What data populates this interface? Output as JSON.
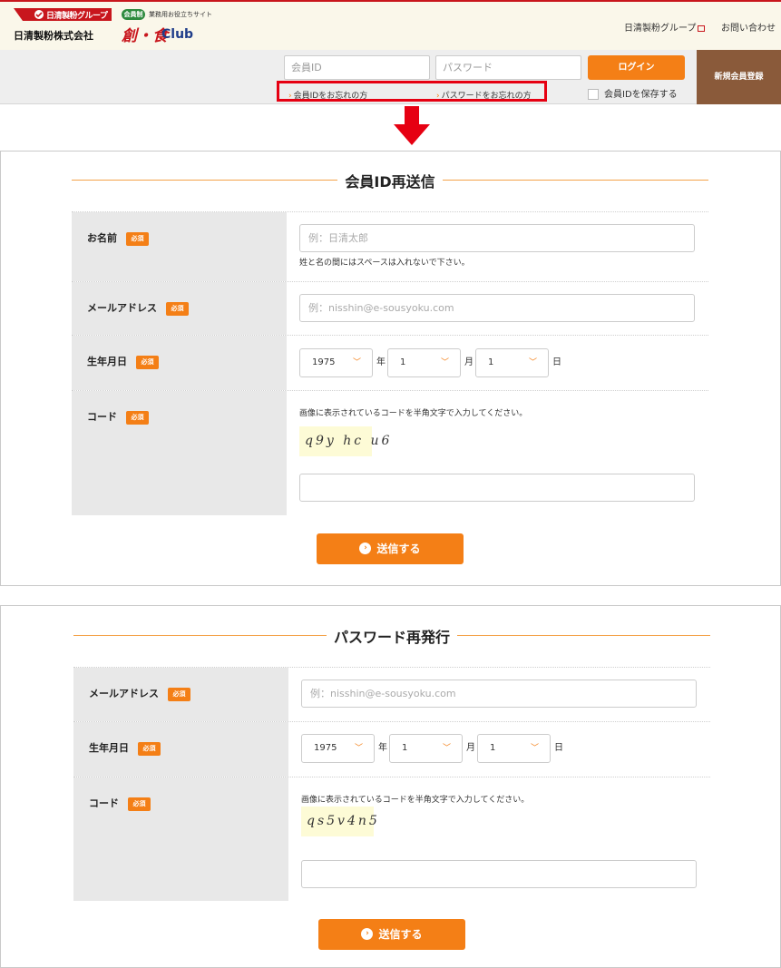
{
  "header": {
    "group_logo_banner": "日清製粉グループ",
    "group_logo_company": "日清製粉株式会社",
    "club_badge": "会員制",
    "club_tagline": "業務用お役立ちサイト",
    "club_name_main": "創・食",
    "club_name_sub": "Club",
    "link_group": "日清製粉グループ",
    "link_contact": "お問い合わせ"
  },
  "login_bar": {
    "id_placeholder": "会員ID",
    "password_placeholder": "パスワード",
    "login_button": "ログイン",
    "forgot_id": "会員IDをお忘れの方",
    "forgot_password": "パスワードをお忘れの方",
    "save_id": "会員IDを保存する",
    "register": "新規会員登録"
  },
  "colors": {
    "accent": "#f47f16",
    "highlight": "#e60012",
    "brand_red": "#c8161d",
    "register_bg": "#8a5a3a"
  },
  "section1": {
    "title": "会員ID再送信",
    "required_label": "必須",
    "name_label": "お名前",
    "name_placeholder": "例：日清太郎",
    "name_hint": "姓と名の間にはスペースは入れないで下さい。",
    "email_label": "メールアドレス",
    "email_placeholder": "例：nisshin@e-sousyoku.com",
    "birth_label": "生年月日",
    "birth_year": "1975",
    "birth_month": "1",
    "birth_day": "1",
    "unit_year": "年",
    "unit_month": "月",
    "unit_day": "日",
    "code_label": "コード",
    "code_hint": "画像に表示されているコードを半角文字で入力してください。",
    "captcha_text": "q9y hc u6",
    "submit": "送信する"
  },
  "section2": {
    "title": "パスワード再発行",
    "required_label": "必須",
    "email_label": "メールアドレス",
    "email_placeholder": "例：nisshin@e-sousyoku.com",
    "birth_label": "生年月日",
    "birth_year": "1975",
    "birth_month": "1",
    "birth_day": "1",
    "unit_year": "年",
    "unit_month": "月",
    "unit_day": "日",
    "code_label": "コード",
    "code_hint": "画像に表示されているコードを半角文字で入力してください。",
    "captcha_text": "qs5v4n5",
    "submit": "送信する"
  },
  "icons": {
    "external_link": "external-link-icon",
    "chevron": "chevron-down-icon",
    "arrow": "arrow-down-icon",
    "submit": "circle-chevron-right-icon"
  }
}
